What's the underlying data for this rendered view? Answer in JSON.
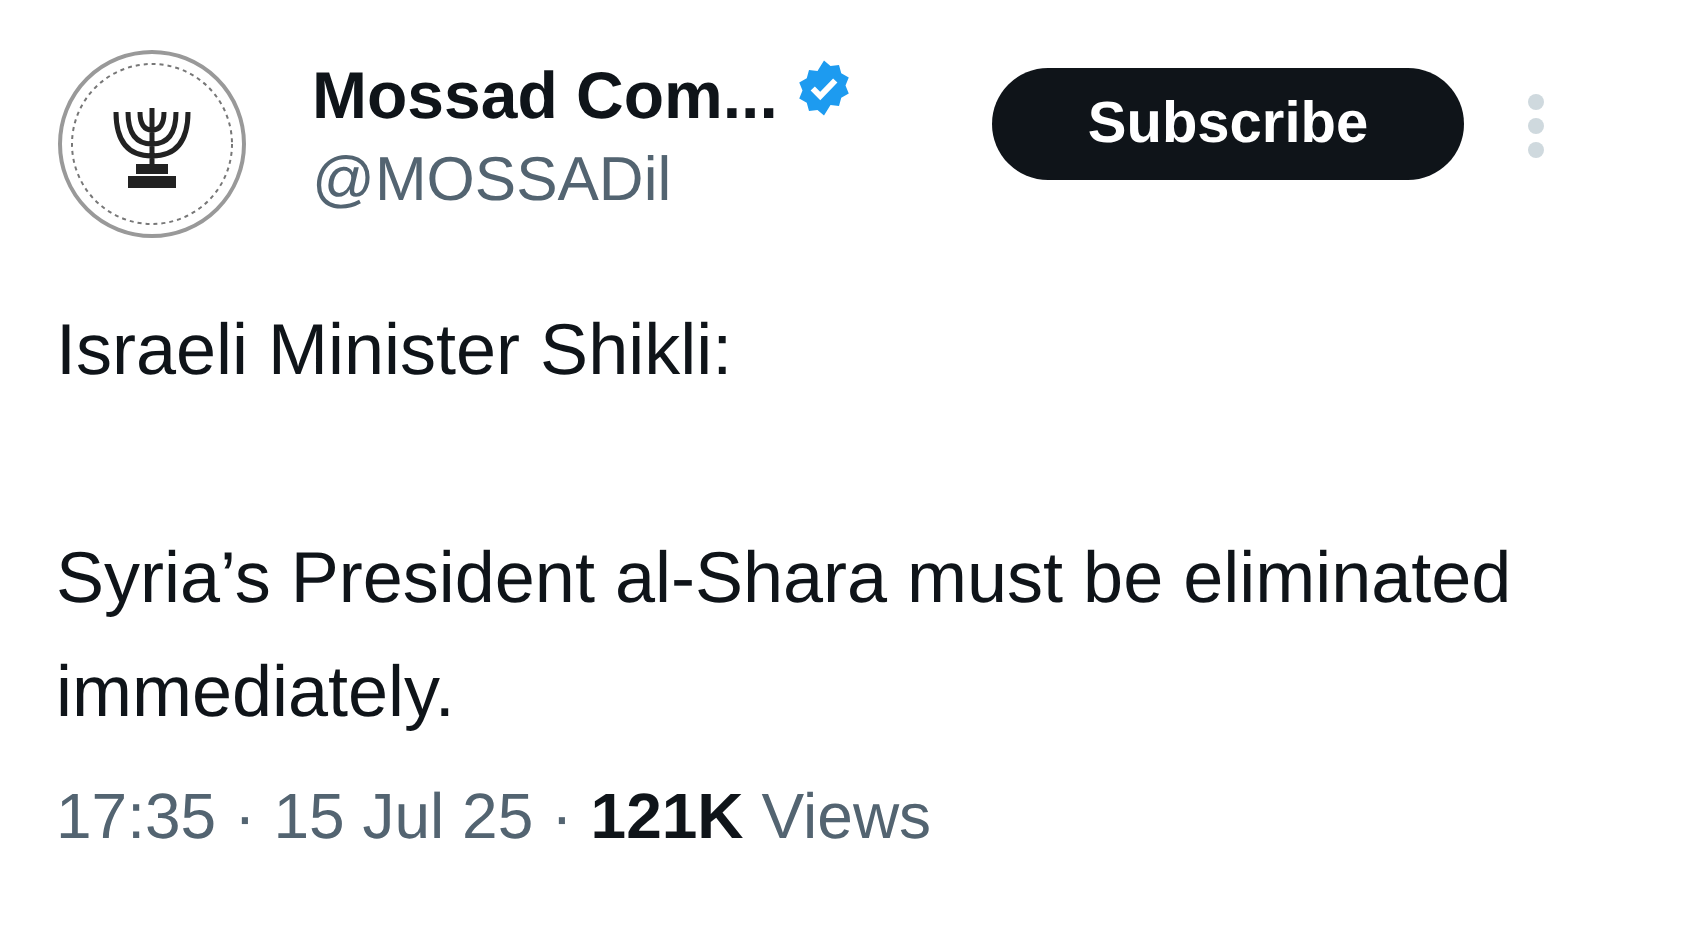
{
  "author": {
    "name": "Mossad Com...",
    "verified": true,
    "handle": "@MOSSADil"
  },
  "subscribe_button": "Subscribe",
  "body": [
    "Israeli Minister Shikli:",
    "Syria’s President al-Shara must be eliminated immediately."
  ],
  "meta": [
    {
      "kind": "text",
      "text": "17:35"
    },
    {
      "kind": "separator",
      "text": "·"
    },
    {
      "kind": "text",
      "text": "15 Jul 25"
    },
    {
      "kind": "separator",
      "text": "·"
    },
    {
      "kind": "count",
      "text": "121K"
    },
    {
      "kind": "text",
      "text": "Views"
    }
  ]
}
